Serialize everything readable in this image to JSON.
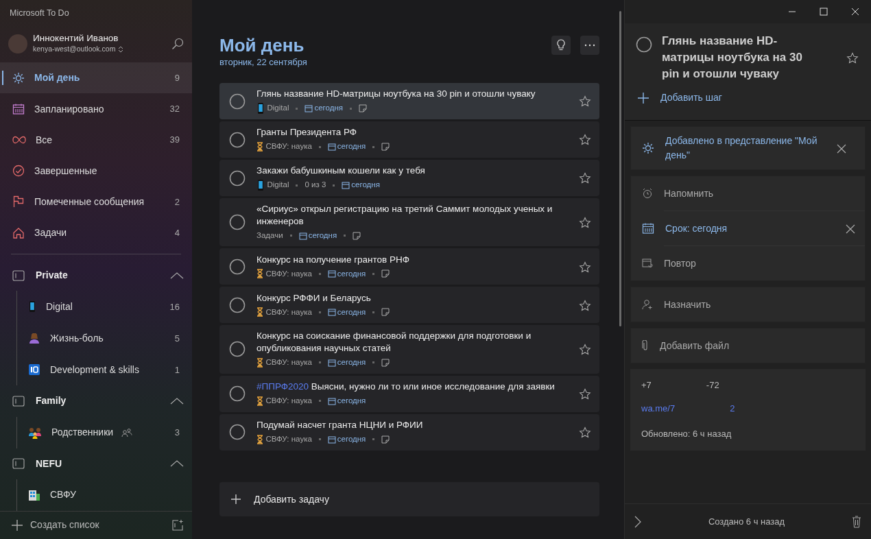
{
  "app_title": "Microsoft To Do",
  "profile": {
    "name": "Иннокентий Иванов",
    "email": "kenya-west@outlook.com"
  },
  "smart_lists": [
    {
      "kind": "sun",
      "label": "Мой день",
      "count": "9",
      "selected": true
    },
    {
      "kind": "calendar",
      "label": "Запланировано",
      "count": "32",
      "selected": false
    },
    {
      "kind": "infinity",
      "label": "Все",
      "count": "39",
      "selected": false
    },
    {
      "kind": "check",
      "label": "Завершенные",
      "selected": false
    },
    {
      "kind": "flag",
      "label": "Помеченные сообщения",
      "count": "2",
      "selected": false
    },
    {
      "kind": "home",
      "label": "Задачи",
      "count": "4",
      "selected": false
    }
  ],
  "groups": [
    {
      "name": "Private",
      "expanded": true,
      "lists": [
        {
          "kind": "phone",
          "label": "Digital",
          "count": "16",
          "shared": false
        },
        {
          "kind": "person",
          "label": "Жизнь-боль",
          "count": "5",
          "shared": false
        },
        {
          "kind": "keycap",
          "label": "Development & skills",
          "count": "1",
          "shared": false
        }
      ]
    },
    {
      "name": "Family",
      "expanded": true,
      "lists": [
        {
          "kind": "family",
          "label": "Родственники",
          "count": "3",
          "shared": true
        }
      ]
    },
    {
      "name": "NEFU",
      "expanded": true,
      "lists": [
        {
          "kind": "building",
          "label": "СВФУ",
          "shared": false
        }
      ]
    }
  ],
  "new_list": "Создать список",
  "main": {
    "title": "Мой день",
    "date": "вторник, 22 сентября",
    "add_task": "Добавить задачу",
    "tasks": [
      {
        "title": "Глянь название HD-матрицы ноутбука на 30 pin и отошли чуваку",
        "selected": true,
        "starred": false,
        "list": {
          "kind": "phone",
          "name": "Digital"
        },
        "due": "сегодня",
        "note": true
      },
      {
        "title": "Гранты  Президента РФ",
        "selected": false,
        "starred": false,
        "list": {
          "kind": "hourglass",
          "name": "СВФУ: наука"
        },
        "due": "сегодня",
        "note": true
      },
      {
        "title": "Закажи бабушкиным кошели как у тебя",
        "selected": false,
        "starred": false,
        "list": {
          "kind": "phone",
          "name": "Digital"
        },
        "steps": "0 из 3",
        "due": "сегодня",
        "note": false
      },
      {
        "title": "«Сириус» открыл регистрацию на третий Саммит молодых ученых и инженеров",
        "selected": false,
        "starred": false,
        "list": {
          "kind": "none",
          "name": "Задачи"
        },
        "due": "сегодня",
        "note": true
      },
      {
        "title": "Конкурс на получение грантов РНФ",
        "selected": false,
        "starred": false,
        "list": {
          "kind": "hourglass",
          "name": "СВФУ: наука"
        },
        "due": "сегодня",
        "note": true
      },
      {
        "title": "Конкурс РФФИ и Беларусь",
        "selected": false,
        "starred": false,
        "list": {
          "kind": "hourglass",
          "name": "СВФУ: наука"
        },
        "due": "сегодня",
        "note": true
      },
      {
        "title": "Конкурс на соискание финансовой поддержки для подготовки и опубликования научных статей",
        "selected": false,
        "starred": false,
        "list": {
          "kind": "hourglass",
          "name": "СВФУ: наука"
        },
        "due": "сегодня",
        "note": true
      },
      {
        "tag": "#ППРФ2020",
        "title": "Выясни, нужно ли то или иное исследование для заявки",
        "selected": false,
        "starred": false,
        "list": {
          "kind": "hourglass",
          "name": "СВФУ: наука"
        },
        "due": "сегодня",
        "note": false
      },
      {
        "title": "Подумай насчет гранта НЦНИ и РФИИ",
        "selected": false,
        "starred": false,
        "list": {
          "kind": "hourglass",
          "name": "СВФУ: наука"
        },
        "due": "сегодня",
        "note": true
      }
    ]
  },
  "detail": {
    "title": "Глянь название HD-матрицы ноутбука на 30 pin и отошли чуваку",
    "completed": false,
    "starred": false,
    "add_step": "Добавить шаг",
    "my_day": "Добавлено в представление \"Мой день\"",
    "rows": [
      {
        "kind": "alarm",
        "label": "Напомнить",
        "active": false
      },
      {
        "kind": "calendar",
        "label": "Срок: сегодня",
        "active": true
      },
      {
        "kind": "repeat",
        "label": "Повтор",
        "active": false
      }
    ],
    "assign": "Назначить",
    "add_file": "Добавить файл",
    "note_lines": [
      [
        {
          "text": "+7",
          "link": false
        },
        {
          "text": "-72",
          "link": false
        }
      ],
      [
        {
          "text": "wa.me/7",
          "link": true
        },
        {
          "text": "2",
          "link": true
        }
      ]
    ],
    "updated": "Обновлено: 6 ч назад",
    "created": "Создано 6 ч назад"
  }
}
